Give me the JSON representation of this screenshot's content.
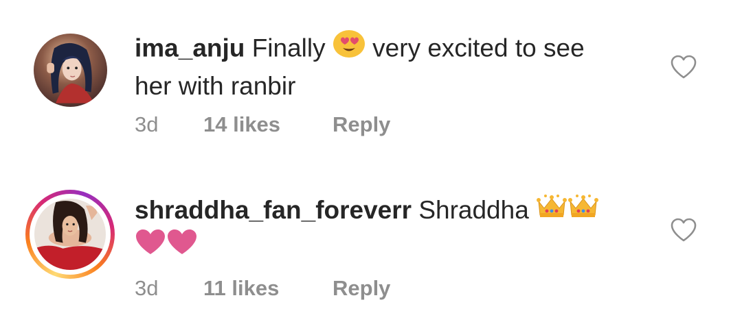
{
  "comments": [
    {
      "username": "ima_anju",
      "text_before_emoji": "Finally",
      "text_after_emoji": "very excited to see",
      "text_line2": "her with ranbir",
      "emoji": [
        "heart-eyes-emoji"
      ],
      "time": "3d",
      "likes": "14 likes",
      "reply": "Reply"
    },
    {
      "username": "shraddha_fan_foreverr",
      "text": "Shraddha",
      "emoji": [
        "crown-emoji",
        "crown-emoji",
        "pink-heart-emoji",
        "pink-heart-emoji"
      ],
      "time": "3d",
      "likes": "11 likes",
      "reply": "Reply",
      "story_ring": true
    }
  ],
  "colors": {
    "text": "#262626",
    "meta": "#8e8e8e",
    "heart_outline": "#8e8e8e",
    "emoji_heart": "#e0588f",
    "crown": "#f6b733"
  }
}
